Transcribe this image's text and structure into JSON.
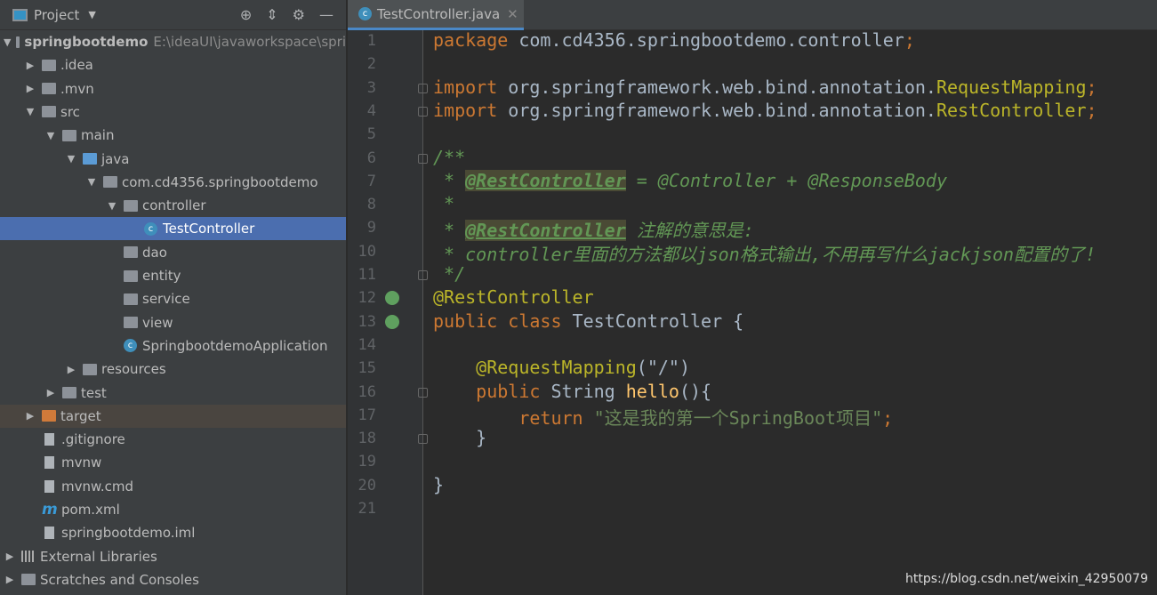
{
  "sidebar": {
    "title": "Project",
    "tools": [
      "locate-icon",
      "collapse-icon",
      "gear-icon",
      "minimize-icon"
    ],
    "items": [
      {
        "label": "springbootdemo",
        "path": "E:\\ideaUI\\javaworkspace\\spri",
        "depth": 0,
        "arrow": "▼",
        "icon": "module",
        "bold": true
      },
      {
        "label": ".idea",
        "depth": 1,
        "arrow": "▶",
        "icon": "folder"
      },
      {
        "label": ".mvn",
        "depth": 1,
        "arrow": "▶",
        "icon": "folder"
      },
      {
        "label": "src",
        "depth": 1,
        "arrow": "▼",
        "icon": "folder"
      },
      {
        "label": "main",
        "depth": 2,
        "arrow": "▼",
        "icon": "folder"
      },
      {
        "label": "java",
        "depth": 3,
        "arrow": "▼",
        "icon": "folder-blue"
      },
      {
        "label": "com.cd4356.springbootdemo",
        "depth": 4,
        "arrow": "▼",
        "icon": "package"
      },
      {
        "label": "controller",
        "depth": 5,
        "arrow": "▼",
        "icon": "package"
      },
      {
        "label": "TestController",
        "depth": 6,
        "arrow": "",
        "icon": "class",
        "selected": true
      },
      {
        "label": "dao",
        "depth": 5,
        "arrow": "",
        "icon": "package"
      },
      {
        "label": "entity",
        "depth": 5,
        "arrow": "",
        "icon": "package"
      },
      {
        "label": "service",
        "depth": 5,
        "arrow": "",
        "icon": "package"
      },
      {
        "label": "view",
        "depth": 5,
        "arrow": "",
        "icon": "package"
      },
      {
        "label": "SpringbootdemoApplication",
        "depth": 5,
        "arrow": "",
        "icon": "class"
      },
      {
        "label": "resources",
        "depth": 3,
        "arrow": "▶",
        "icon": "folder"
      },
      {
        "label": "test",
        "depth": 2,
        "arrow": "▶",
        "icon": "folder"
      },
      {
        "label": "target",
        "depth": 1,
        "arrow": "▶",
        "icon": "folder-orange",
        "excluded": true
      },
      {
        "label": ".gitignore",
        "depth": 1,
        "arrow": "",
        "icon": "file"
      },
      {
        "label": "mvnw",
        "depth": 1,
        "arrow": "",
        "icon": "file"
      },
      {
        "label": "mvnw.cmd",
        "depth": 1,
        "arrow": "",
        "icon": "file"
      },
      {
        "label": "pom.xml",
        "depth": 1,
        "arrow": "",
        "icon": "maven"
      },
      {
        "label": "springbootdemo.iml",
        "depth": 1,
        "arrow": "",
        "icon": "file"
      },
      {
        "label": "External Libraries",
        "depth": 0,
        "arrow": "▶",
        "icon": "libraries"
      },
      {
        "label": "Scratches and Consoles",
        "depth": 0,
        "arrow": "▶",
        "icon": "scratches"
      }
    ]
  },
  "editor": {
    "tab": "TestController.java",
    "lines": [
      [
        [
          "kw",
          "package "
        ],
        [
          "",
          "com.cd4356.springbootdemo.controller"
        ],
        [
          "kw",
          ";"
        ]
      ],
      [],
      [
        [
          "kw",
          "import "
        ],
        [
          "",
          "org.springframework.web.bind.annotation."
        ],
        [
          "an",
          "RequestMapping"
        ],
        [
          "kw",
          ";"
        ]
      ],
      [
        [
          "kw",
          "import "
        ],
        [
          "",
          "org.springframework.web.bind.annotation."
        ],
        [
          "an",
          "RestController"
        ],
        [
          "kw",
          ";"
        ]
      ],
      [],
      [
        [
          "cm",
          "/**"
        ]
      ],
      [
        [
          "cm",
          " * "
        ],
        [
          "cmb",
          "@RestController"
        ],
        [
          "cm",
          " = @Controller + @ResponseBody"
        ]
      ],
      [
        [
          "cm",
          " *"
        ]
      ],
      [
        [
          "cm",
          " * "
        ],
        [
          "cmb",
          "@RestController"
        ],
        [
          "cm",
          " 注解的意思是:"
        ]
      ],
      [
        [
          "cm",
          " * controller里面的方法都以json格式输出,不用再写什么jackjson配置的了!"
        ]
      ],
      [
        [
          "cm",
          " */"
        ]
      ],
      [
        [
          "an",
          "@RestController"
        ]
      ],
      [
        [
          "kw",
          "public class "
        ],
        [
          "",
          "TestController {"
        ]
      ],
      [],
      [
        [
          "",
          "  "
        ],
        [
          "an",
          "  @RequestMapping"
        ],
        [
          "",
          "(\"/\")"
        ]
      ],
      [
        [
          "kw",
          "    public "
        ],
        [
          "",
          "String "
        ],
        [
          "fn",
          "hello"
        ],
        [
          "",
          "(){"
        ]
      ],
      [
        [
          "kw",
          "        return "
        ],
        [
          "st",
          "\"这是我的第一个SpringBoot项目\""
        ],
        [
          "kw",
          ";"
        ]
      ],
      [
        [
          "",
          "    }"
        ]
      ],
      [],
      [
        [
          "",
          "}"
        ]
      ],
      []
    ]
  },
  "watermark": "https://blog.csdn.net/weixin_42950079"
}
